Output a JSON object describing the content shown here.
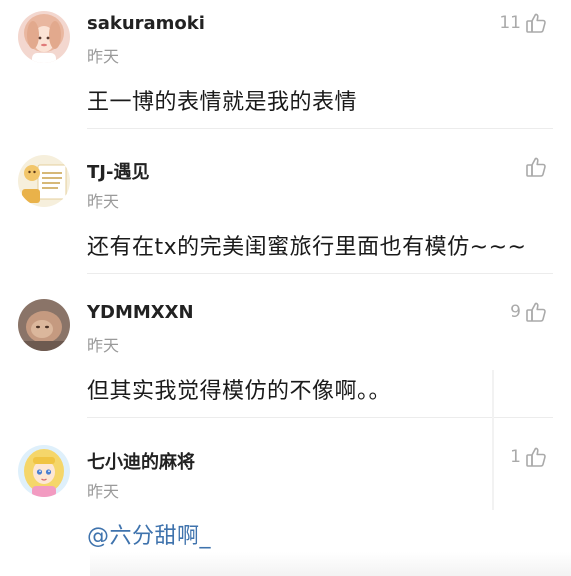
{
  "comments": [
    {
      "username": "sakuramoki",
      "time": "昨天",
      "text": "王一博的表情就是我的表情",
      "likes": "11",
      "avatar_icon": "girl-avatar-icon"
    },
    {
      "username": "TJ-遇见",
      "time": "昨天",
      "text": "还有在tx的完美闺蜜旅行里面也有模仿~~~",
      "likes": "",
      "avatar_icon": "cartoon-note-avatar-icon"
    },
    {
      "username": "YDMMXXN",
      "time": "昨天",
      "text": "但其实我觉得模仿的不像啊。。",
      "likes": "9",
      "avatar_icon": "baby-avatar-icon"
    },
    {
      "username": "七小迪的麻将",
      "time": "昨天",
      "text": "@六分甜啊_",
      "likes": "1",
      "avatar_icon": "anime-girl-avatar-icon"
    }
  ],
  "like_icon": "thumbs-up-icon",
  "colors": {
    "username": "#222222",
    "time": "#9a9a9a",
    "content": "#1a1a1a",
    "mention": "#3f73ad",
    "icon": "#aaaaaa"
  }
}
